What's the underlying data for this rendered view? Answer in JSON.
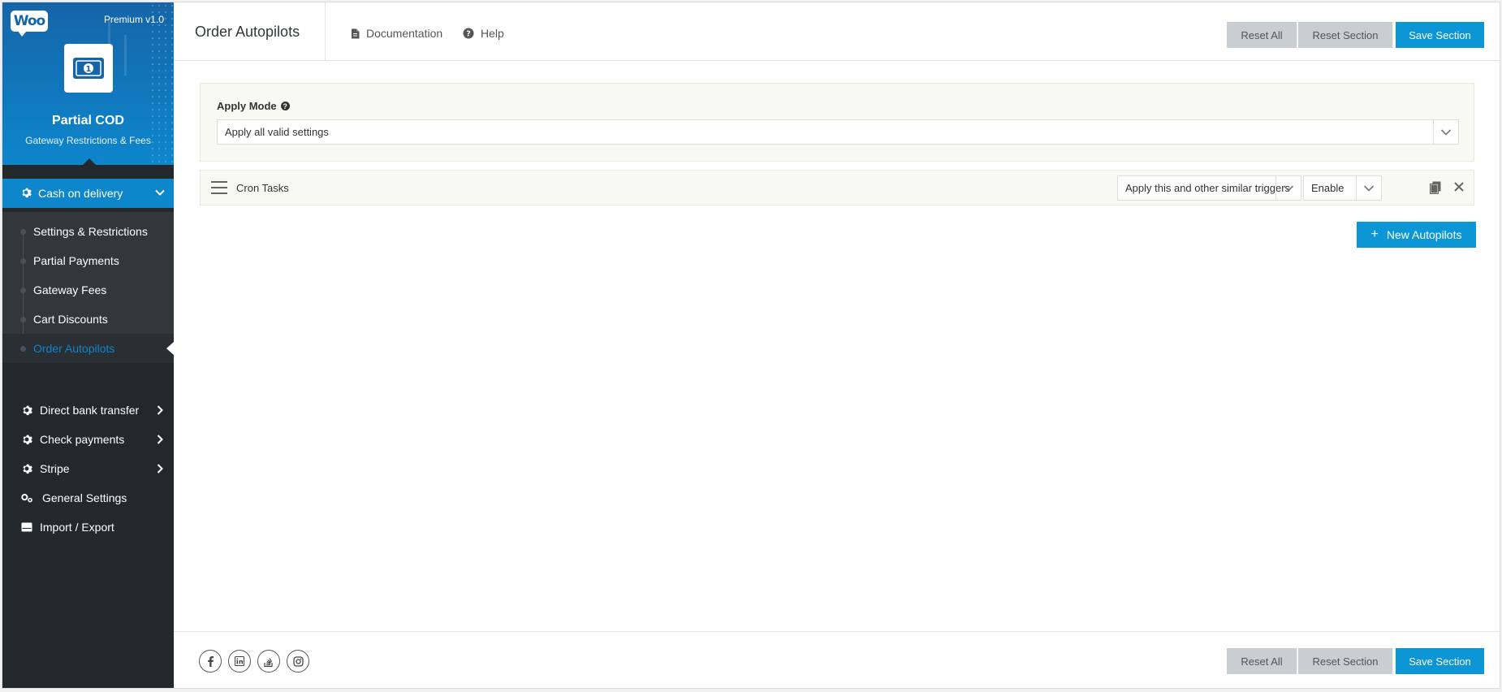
{
  "brand": {
    "logo_text": "Woo",
    "version": "Premium v1.0",
    "title": "Partial COD",
    "subtitle": "Gateway Restrictions & Fees"
  },
  "sidebar": {
    "active_group": "Cash on delivery",
    "subitems": [
      {
        "label": "Settings & Restrictions",
        "active": false
      },
      {
        "label": "Partial Payments",
        "active": false
      },
      {
        "label": "Gateway Fees",
        "active": false
      },
      {
        "label": "Cart Discounts",
        "active": false
      },
      {
        "label": "Order Autopilots",
        "active": true
      }
    ],
    "items": [
      {
        "label": "Direct bank transfer",
        "icon": "gear-icon",
        "has_chevron": true
      },
      {
        "label": "Check payments",
        "icon": "gear-icon",
        "has_chevron": true
      },
      {
        "label": "Stripe",
        "icon": "gear-icon",
        "has_chevron": true
      },
      {
        "label": "General Settings",
        "icon": "gears-icon",
        "has_chevron": false
      },
      {
        "label": "Import / Export",
        "icon": "hdd-icon",
        "has_chevron": false
      }
    ]
  },
  "header": {
    "title": "Order Autopilots",
    "links": {
      "documentation": "Documentation",
      "help": "Help"
    },
    "buttons": {
      "reset_all": "Reset All",
      "reset_section": "Reset Section",
      "save_section": "Save Section"
    }
  },
  "apply_mode": {
    "label": "Apply Mode",
    "value": "Apply all valid settings"
  },
  "autopilot_row": {
    "title": "Cron Tasks",
    "trigger_select": "Apply this and other similar triggers",
    "status_select": "Enable"
  },
  "new_button": "New Autopilots",
  "footer": {
    "social": [
      "facebook-icon",
      "linkedin-icon",
      "stackoverflow-icon",
      "instagram-icon"
    ],
    "buttons": {
      "reset_all": "Reset All",
      "reset_section": "Reset Section",
      "save_section": "Save Section"
    }
  },
  "colors": {
    "accent": "#0d96d6",
    "sidebar_bg": "#23282d",
    "submenu_bg": "#32373c",
    "brand_gradient_start": "#1565a8",
    "brand_gradient_end": "#0d86cc",
    "button_gray": "#c9ced2",
    "panel_bg": "#f9f9f4"
  }
}
